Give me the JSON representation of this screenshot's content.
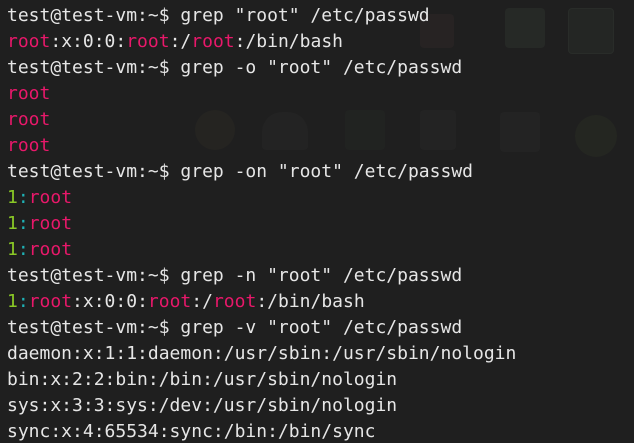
{
  "terminal": {
    "cmd1": "test@test-vm:~$ grep \"root\" /etc/passwd",
    "r1": {
      "m1": "root",
      "t1": ":x:0:0:",
      "m2": "root",
      "t2": ":/",
      "m3": "root",
      "t3": ":/bin/bash"
    },
    "cmd2": "test@test-vm:~$ grep -o \"root\" /etc/passwd",
    "o1": "root",
    "o2": "root",
    "o3": "root",
    "cmd3": "test@test-vm:~$ grep -on \"root\" /etc/passwd",
    "on1": {
      "num": "1",
      "sep": ":",
      "match": "root"
    },
    "on2": {
      "num": "1",
      "sep": ":",
      "match": "root"
    },
    "on3": {
      "num": "1",
      "sep": ":",
      "match": "root"
    },
    "cmd4": "test@test-vm:~$ grep -n \"root\" /etc/passwd",
    "n1": {
      "num": "1",
      "sep": ":",
      "m1": "root",
      "t1": ":x:0:0:",
      "m2": "root",
      "t2": ":/",
      "m3": "root",
      "t3": ":/bin/bash"
    },
    "cmd5": "test@test-vm:~$ grep -v \"root\" /etc/passwd",
    "v1": "daemon:x:1:1:daemon:/usr/sbin:/usr/sbin/nologin",
    "v2": "bin:x:2:2:bin:/bin:/usr/sbin/nologin",
    "v3": "sys:x:3:3:sys:/dev:/usr/sbin/nologin",
    "v4": "sync:x:4:65534:sync:/bin:/bin/sync"
  },
  "colors": {
    "background": "#1f1f1f",
    "text": "#e6e6e6",
    "match": "#e8186a",
    "line_number": "#8ac926",
    "separator": "#1fb1b5"
  }
}
